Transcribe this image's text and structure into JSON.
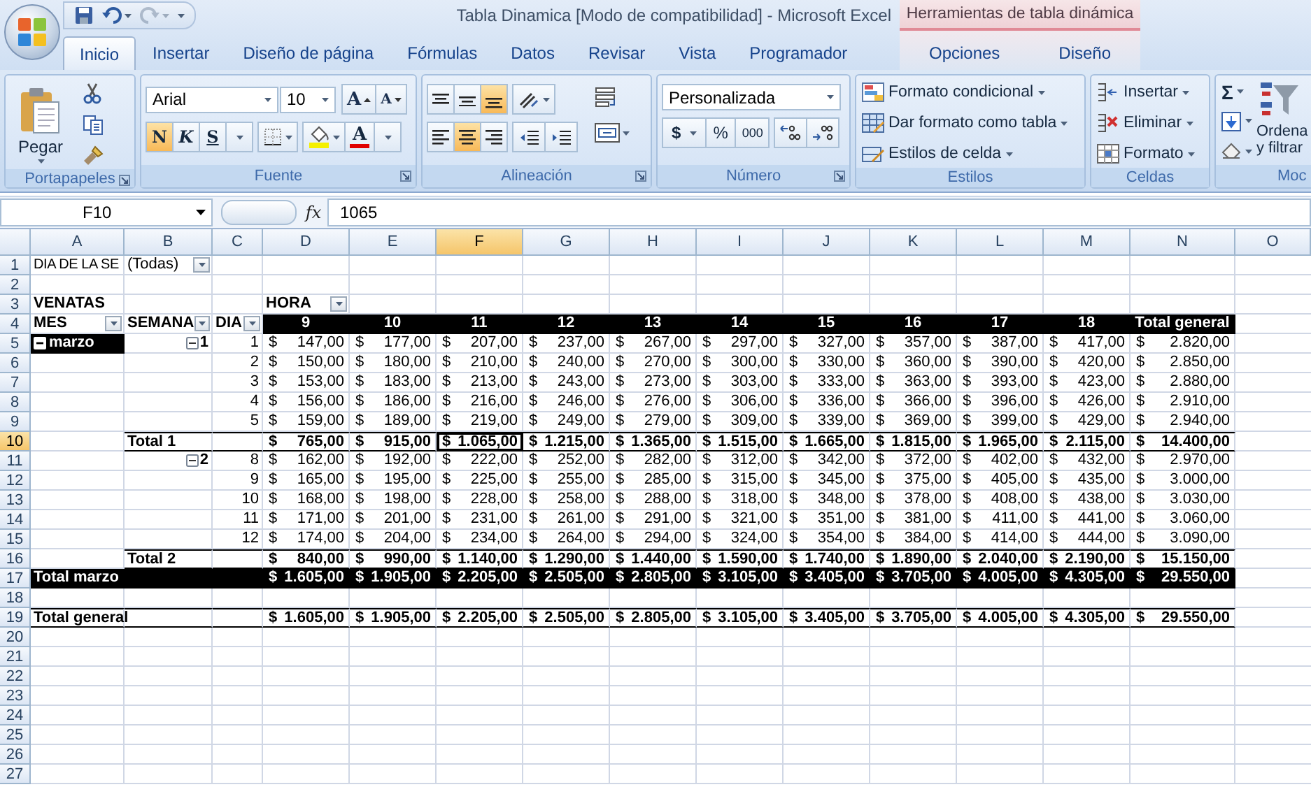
{
  "title_bar": {
    "title": "Tabla Dinamica  [Modo de compatibilidad] - Microsoft Excel",
    "contextual_title": "Herramientas de tabla dinámica"
  },
  "tabs": [
    {
      "label": "Inicio",
      "selected": true,
      "contextual": false
    },
    {
      "label": "Insertar",
      "selected": false,
      "contextual": false
    },
    {
      "label": "Diseño de página",
      "selected": false,
      "contextual": false
    },
    {
      "label": "Fórmulas",
      "selected": false,
      "contextual": false
    },
    {
      "label": "Datos",
      "selected": false,
      "contextual": false
    },
    {
      "label": "Revisar",
      "selected": false,
      "contextual": false
    },
    {
      "label": "Vista",
      "selected": false,
      "contextual": false
    },
    {
      "label": "Programador",
      "selected": false,
      "contextual": false
    },
    {
      "label": "Opciones",
      "selected": false,
      "contextual": true
    },
    {
      "label": "Diseño",
      "selected": false,
      "contextual": true
    }
  ],
  "ribbon": {
    "clipboard": {
      "label": "Portapapeles",
      "paste": "Pegar"
    },
    "font": {
      "label": "Fuente",
      "family": "Arial",
      "size": "10",
      "grow": "A",
      "shrink": "A",
      "font_color": "A",
      "styles": [
        {
          "label": "N",
          "kind": "bold",
          "selected": true
        },
        {
          "label": "K",
          "kind": "italic",
          "selected": false
        },
        {
          "label": "S",
          "kind": "underline",
          "selected": false
        }
      ]
    },
    "alignment": {
      "label": "Alineación",
      "vertical": [
        {
          "kind": "top",
          "selected": false
        },
        {
          "kind": "middle",
          "selected": false
        },
        {
          "kind": "bottom",
          "selected": true
        }
      ],
      "horizontal": [
        {
          "kind": "left",
          "selected": false
        },
        {
          "kind": "center",
          "selected": true
        },
        {
          "kind": "right",
          "selected": false
        }
      ]
    },
    "number": {
      "label": "Número",
      "format": "Personalizada",
      "currency": "$",
      "percent": "%",
      "thousands": "000"
    },
    "styles": {
      "label": "Estilos",
      "commands": [
        {
          "label": "Formato condicional",
          "kind": "conditional"
        },
        {
          "label": "Dar formato como tabla",
          "kind": "table"
        },
        {
          "label": "Estilos de celda",
          "kind": "cell"
        }
      ]
    },
    "cells": {
      "label": "Celdas",
      "commands": [
        {
          "label": "Insertar",
          "kind": "insert"
        },
        {
          "label": "Eliminar",
          "kind": "delete"
        },
        {
          "label": "Formato",
          "kind": "format"
        }
      ]
    },
    "editing": {
      "label": "Moc",
      "sum": "Σ",
      "sort": "Ordena y filtrar"
    }
  },
  "formula_bar": {
    "cell": "F10",
    "function_label": "fx",
    "value": "1065"
  },
  "sheet": {
    "columns": [
      {
        "label": "A",
        "selected": false
      },
      {
        "label": "B",
        "selected": false
      },
      {
        "label": "C",
        "selected": false
      },
      {
        "label": "D",
        "selected": false
      },
      {
        "label": "E",
        "selected": false
      },
      {
        "label": "F",
        "selected": true
      },
      {
        "label": "G",
        "selected": false
      },
      {
        "label": "H",
        "selected": false
      },
      {
        "label": "I",
        "selected": false
      },
      {
        "label": "J",
        "selected": false
      },
      {
        "label": "K",
        "selected": false
      },
      {
        "label": "L",
        "selected": false
      },
      {
        "label": "M",
        "selected": false
      },
      {
        "label": "N",
        "selected": false
      },
      {
        "label": "O",
        "selected": false
      }
    ],
    "rows": [
      {
        "number": "1",
        "selected": false,
        "cells": [
          {
            "kind": "text_narrow",
            "text": "DIA DE LA SE"
          },
          {
            "kind": "filter",
            "text": "(Todas)"
          }
        ]
      },
      {
        "number": "2",
        "selected": false
      },
      {
        "number": "3",
        "selected": false,
        "cells": [
          {
            "kind": "bold",
            "text": "VENATAS"
          },
          null,
          null,
          {
            "kind": "filter_header",
            "text": "HORA"
          }
        ]
      },
      {
        "number": "4",
        "selected": false,
        "cells": [
          {
            "kind": "filter_header",
            "text": "MES"
          },
          {
            "kind": "filter_header",
            "text": "SEMANA"
          },
          {
            "kind": "filter_header",
            "text": "DIA"
          },
          {
            "kind": "dark",
            "text": "9"
          },
          {
            "kind": "dark",
            "text": "10"
          },
          {
            "kind": "dark",
            "text": "11"
          },
          {
            "kind": "dark",
            "text": "12"
          },
          {
            "kind": "dark",
            "text": "13"
          },
          {
            "kind": "dark",
            "text": "14"
          },
          {
            "kind": "dark",
            "text": "15"
          },
          {
            "kind": "dark",
            "text": "16"
          },
          {
            "kind": "dark",
            "text": "17"
          },
          {
            "kind": "dark",
            "text": "18"
          },
          {
            "kind": "dark",
            "text": "Total general"
          }
        ]
      },
      {
        "number": "5",
        "selected": false,
        "cells": [
          {
            "kind": "dark_group",
            "text": "marzo"
          },
          {
            "kind": "group",
            "text": "1"
          },
          {
            "kind": "num",
            "text": "1"
          },
          {
            "kind": "money",
            "text": "$ 147,00"
          },
          {
            "kind": "money",
            "text": "$ 177,00"
          },
          {
            "kind": "money",
            "text": "$ 207,00"
          },
          {
            "kind": "money",
            "text": "$ 237,00"
          },
          {
            "kind": "money",
            "text": "$ 267,00"
          },
          {
            "kind": "money",
            "text": "$ 297,00"
          },
          {
            "kind": "money",
            "text": "$ 327,00"
          },
          {
            "kind": "money",
            "text": "$ 357,00"
          },
          {
            "kind": "money",
            "text": "$ 387,00"
          },
          {
            "kind": "money",
            "text": "$ 417,00"
          },
          {
            "kind": "money",
            "text": "$ 2.820,00"
          }
        ]
      },
      {
        "number": "6",
        "selected": false,
        "cells": [
          null,
          null,
          {
            "kind": "num",
            "text": "2"
          },
          {
            "kind": "money",
            "text": "$ 150,00"
          },
          {
            "kind": "money",
            "text": "$ 180,00"
          },
          {
            "kind": "money",
            "text": "$ 210,00"
          },
          {
            "kind": "money",
            "text": "$ 240,00"
          },
          {
            "kind": "money",
            "text": "$ 270,00"
          },
          {
            "kind": "money",
            "text": "$ 300,00"
          },
          {
            "kind": "money",
            "text": "$ 330,00"
          },
          {
            "kind": "money",
            "text": "$ 360,00"
          },
          {
            "kind": "money",
            "text": "$ 390,00"
          },
          {
            "kind": "money",
            "text": "$ 420,00"
          },
          {
            "kind": "money",
            "text": "$ 2.850,00"
          }
        ]
      },
      {
        "number": "7",
        "selected": false,
        "cells": [
          null,
          null,
          {
            "kind": "num",
            "text": "3"
          },
          {
            "kind": "money",
            "text": "$ 153,00"
          },
          {
            "kind": "money",
            "text": "$ 183,00"
          },
          {
            "kind": "money",
            "text": "$ 213,00"
          },
          {
            "kind": "money",
            "text": "$ 243,00"
          },
          {
            "kind": "money",
            "text": "$ 273,00"
          },
          {
            "kind": "money",
            "text": "$ 303,00"
          },
          {
            "kind": "money",
            "text": "$ 333,00"
          },
          {
            "kind": "money",
            "text": "$ 363,00"
          },
          {
            "kind": "money",
            "text": "$ 393,00"
          },
          {
            "kind": "money",
            "text": "$ 423,00"
          },
          {
            "kind": "money",
            "text": "$ 2.880,00"
          }
        ]
      },
      {
        "number": "8",
        "selected": false,
        "cells": [
          null,
          null,
          {
            "kind": "num",
            "text": "4"
          },
          {
            "kind": "money",
            "text": "$ 156,00"
          },
          {
            "kind": "money",
            "text": "$ 186,00"
          },
          {
            "kind": "money",
            "text": "$ 216,00"
          },
          {
            "kind": "money",
            "text": "$ 246,00"
          },
          {
            "kind": "money",
            "text": "$ 276,00"
          },
          {
            "kind": "money",
            "text": "$ 306,00"
          },
          {
            "kind": "money",
            "text": "$ 336,00"
          },
          {
            "kind": "money",
            "text": "$ 366,00"
          },
          {
            "kind": "money",
            "text": "$ 396,00"
          },
          {
            "kind": "money",
            "text": "$ 426,00"
          },
          {
            "kind": "money",
            "text": "$ 2.910,00"
          }
        ]
      },
      {
        "number": "9",
        "selected": false,
        "cells": [
          null,
          null,
          {
            "kind": "num",
            "text": "5"
          },
          {
            "kind": "money",
            "text": "$ 159,00"
          },
          {
            "kind": "money",
            "text": "$ 189,00"
          },
          {
            "kind": "money",
            "text": "$ 219,00"
          },
          {
            "kind": "money",
            "text": "$ 249,00"
          },
          {
            "kind": "money",
            "text": "$ 279,00"
          },
          {
            "kind": "money",
            "text": "$ 309,00"
          },
          {
            "kind": "money",
            "text": "$ 339,00"
          },
          {
            "kind": "money",
            "text": "$ 369,00"
          },
          {
            "kind": "money",
            "text": "$ 399,00"
          },
          {
            "kind": "money",
            "text": "$ 429,00"
          },
          {
            "kind": "money",
            "text": "$ 2.940,00"
          }
        ]
      },
      {
        "number": "10",
        "selected": true,
        "cells": [
          null,
          {
            "kind": "total_label",
            "text": "Total 1"
          },
          {
            "kind": "total_fill"
          },
          {
            "kind": "money_total",
            "text": "$ 765,00"
          },
          {
            "kind": "money_total",
            "text": "$ 915,00"
          },
          {
            "kind": "money_total",
            "text": "$ 1.065,00"
          },
          {
            "kind": "money_total",
            "text": "$ 1.215,00"
          },
          {
            "kind": "money_total",
            "text": "$ 1.365,00"
          },
          {
            "kind": "money_total",
            "text": "$ 1.515,00"
          },
          {
            "kind": "money_total",
            "text": "$ 1.665,00"
          },
          {
            "kind": "money_total",
            "text": "$ 1.815,00"
          },
          {
            "kind": "money_total",
            "text": "$ 1.965,00"
          },
          {
            "kind": "money_total",
            "text": "$ 2.115,00"
          },
          {
            "kind": "money_total",
            "text": "$ 14.400,00"
          }
        ]
      },
      {
        "number": "11",
        "selected": false,
        "cells": [
          null,
          {
            "kind": "group",
            "text": "2"
          },
          {
            "kind": "num",
            "text": "8"
          },
          {
            "kind": "money",
            "text": "$ 162,00"
          },
          {
            "kind": "money",
            "text": "$ 192,00"
          },
          {
            "kind": "money",
            "text": "$ 222,00"
          },
          {
            "kind": "money",
            "text": "$ 252,00"
          },
          {
            "kind": "money",
            "text": "$ 282,00"
          },
          {
            "kind": "money",
            "text": "$ 312,00"
          },
          {
            "kind": "money",
            "text": "$ 342,00"
          },
          {
            "kind": "money",
            "text": "$ 372,00"
          },
          {
            "kind": "money",
            "text": "$ 402,00"
          },
          {
            "kind": "money",
            "text": "$ 432,00"
          },
          {
            "kind": "money",
            "text": "$ 2.970,00"
          }
        ]
      },
      {
        "number": "12",
        "selected": false,
        "cells": [
          null,
          null,
          {
            "kind": "num",
            "text": "9"
          },
          {
            "kind": "money",
            "text": "$ 165,00"
          },
          {
            "kind": "money",
            "text": "$ 195,00"
          },
          {
            "kind": "money",
            "text": "$ 225,00"
          },
          {
            "kind": "money",
            "text": "$ 255,00"
          },
          {
            "kind": "money",
            "text": "$ 285,00"
          },
          {
            "kind": "money",
            "text": "$ 315,00"
          },
          {
            "kind": "money",
            "text": "$ 345,00"
          },
          {
            "kind": "money",
            "text": "$ 375,00"
          },
          {
            "kind": "money",
            "text": "$ 405,00"
          },
          {
            "kind": "money",
            "text": "$ 435,00"
          },
          {
            "kind": "money",
            "text": "$ 3.000,00"
          }
        ]
      },
      {
        "number": "13",
        "selected": false,
        "cells": [
          null,
          null,
          {
            "kind": "num",
            "text": "10"
          },
          {
            "kind": "money",
            "text": "$ 168,00"
          },
          {
            "kind": "money",
            "text": "$ 198,00"
          },
          {
            "kind": "money",
            "text": "$ 228,00"
          },
          {
            "kind": "money",
            "text": "$ 258,00"
          },
          {
            "kind": "money",
            "text": "$ 288,00"
          },
          {
            "kind": "money",
            "text": "$ 318,00"
          },
          {
            "kind": "money",
            "text": "$ 348,00"
          },
          {
            "kind": "money",
            "text": "$ 378,00"
          },
          {
            "kind": "money",
            "text": "$ 408,00"
          },
          {
            "kind": "money",
            "text": "$ 438,00"
          },
          {
            "kind": "money",
            "text": "$ 3.030,00"
          }
        ]
      },
      {
        "number": "14",
        "selected": false,
        "cells": [
          null,
          null,
          {
            "kind": "num",
            "text": "11"
          },
          {
            "kind": "money",
            "text": "$ 171,00"
          },
          {
            "kind": "money",
            "text": "$ 201,00"
          },
          {
            "kind": "money",
            "text": "$ 231,00"
          },
          {
            "kind": "money",
            "text": "$ 261,00"
          },
          {
            "kind": "money",
            "text": "$ 291,00"
          },
          {
            "kind": "money",
            "text": "$ 321,00"
          },
          {
            "kind": "money",
            "text": "$ 351,00"
          },
          {
            "kind": "money",
            "text": "$ 381,00"
          },
          {
            "kind": "money",
            "text": "$ 411,00"
          },
          {
            "kind": "money",
            "text": "$ 441,00"
          },
          {
            "kind": "money",
            "text": "$ 3.060,00"
          }
        ]
      },
      {
        "number": "15",
        "selected": false,
        "cells": [
          null,
          null,
          {
            "kind": "num",
            "text": "12"
          },
          {
            "kind": "money",
            "text": "$ 174,00"
          },
          {
            "kind": "money",
            "text": "$ 204,00"
          },
          {
            "kind": "money",
            "text": "$ 234,00"
          },
          {
            "kind": "money",
            "text": "$ 264,00"
          },
          {
            "kind": "money",
            "text": "$ 294,00"
          },
          {
            "kind": "money",
            "text": "$ 324,00"
          },
          {
            "kind": "money",
            "text": "$ 354,00"
          },
          {
            "kind": "money",
            "text": "$ 384,00"
          },
          {
            "kind": "money",
            "text": "$ 414,00"
          },
          {
            "kind": "money",
            "text": "$ 444,00"
          },
          {
            "kind": "money",
            "text": "$ 3.090,00"
          }
        ]
      },
      {
        "number": "16",
        "selected": false,
        "cells": [
          null,
          {
            "kind": "total_label",
            "text": "Total 2"
          },
          {
            "kind": "total_fill"
          },
          {
            "kind": "money_total",
            "text": "$ 840,00"
          },
          {
            "kind": "money_total",
            "text": "$ 990,00"
          },
          {
            "kind": "money_total",
            "text": "$ 1.140,00"
          },
          {
            "kind": "money_total",
            "text": "$ 1.290,00"
          },
          {
            "kind": "money_total",
            "text": "$ 1.440,00"
          },
          {
            "kind": "money_total",
            "text": "$ 1.590,00"
          },
          {
            "kind": "money_total",
            "text": "$ 1.740,00"
          },
          {
            "kind": "money_total",
            "text": "$ 1.890,00"
          },
          {
            "kind": "money_total",
            "text": "$ 2.040,00"
          },
          {
            "kind": "money_total",
            "text": "$ 2.190,00"
          },
          {
            "kind": "money_total",
            "text": "$ 15.150,00"
          }
        ]
      },
      {
        "number": "17",
        "selected": false,
        "cells": [
          {
            "kind": "dark_label",
            "text": "Total marzo"
          },
          {
            "kind": "dark_fill"
          },
          {
            "kind": "dark_fill"
          },
          {
            "kind": "dark_money",
            "text": "$ 1.605,00"
          },
          {
            "kind": "dark_money",
            "text": "$ 1.905,00"
          },
          {
            "kind": "dark_money",
            "text": "$ 2.205,00"
          },
          {
            "kind": "dark_money",
            "text": "$ 2.505,00"
          },
          {
            "kind": "dark_money",
            "text": "$ 2.805,00"
          },
          {
            "kind": "dark_money",
            "text": "$ 3.105,00"
          },
          {
            "kind": "dark_money",
            "text": "$ 3.405,00"
          },
          {
            "kind": "dark_money",
            "text": "$ 3.705,00"
          },
          {
            "kind": "dark_money",
            "text": "$ 4.005,00"
          },
          {
            "kind": "dark_money",
            "text": "$ 4.305,00"
          },
          {
            "kind": "dark_money",
            "text": "$ 29.550,00"
          }
        ]
      },
      {
        "number": "18",
        "selected": false
      },
      {
        "number": "19",
        "selected": false,
        "cells": [
          {
            "kind": "grand_label",
            "text": "Total general"
          },
          {
            "kind": "grand_fill"
          },
          {
            "kind": "grand_fill"
          },
          {
            "kind": "grand_money",
            "text": "$ 1.605,00"
          },
          {
            "kind": "grand_money",
            "text": "$ 1.905,00"
          },
          {
            "kind": "grand_money",
            "text": "$ 2.205,00"
          },
          {
            "kind": "grand_money",
            "text": "$ 2.505,00"
          },
          {
            "kind": "grand_money",
            "text": "$ 2.805,00"
          },
          {
            "kind": "grand_money",
            "text": "$ 3.105,00"
          },
          {
            "kind": "grand_money",
            "text": "$ 3.405,00"
          },
          {
            "kind": "grand_money",
            "text": "$ 3.705,00"
          },
          {
            "kind": "grand_money",
            "text": "$ 4.005,00"
          },
          {
            "kind": "grand_money",
            "text": "$ 4.305,00"
          },
          {
            "kind": "grand_money",
            "text": "$ 29.550,00"
          }
        ]
      },
      {
        "number": "20",
        "selected": false
      },
      {
        "number": "21",
        "selected": false
      },
      {
        "number": "22",
        "selected": false
      },
      {
        "number": "23",
        "selected": false
      },
      {
        "number": "24",
        "selected": false
      },
      {
        "number": "25",
        "selected": false
      },
      {
        "number": "26",
        "selected": false
      },
      {
        "number": "27",
        "selected": false
      }
    ]
  }
}
